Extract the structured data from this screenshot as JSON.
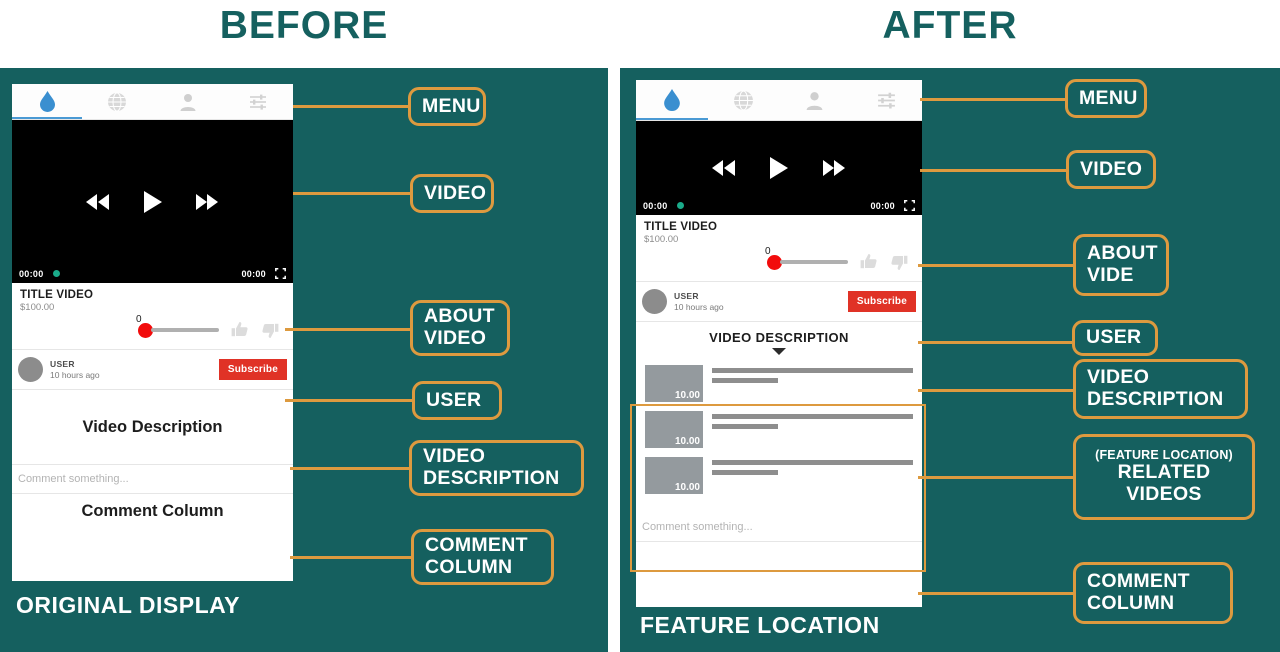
{
  "headings": {
    "before": "BEFORE",
    "after": "AFTER"
  },
  "captions": {
    "before": "ORIGINAL DISPLAY",
    "after": "FEATURE LOCATION"
  },
  "colors": {
    "panel_teal": "#15605F",
    "callout_orange": "#DD9A3F",
    "heading_teal": "#15605F",
    "subscribe_red": "#E03226",
    "slider_red": "#F20C0C",
    "progress_green": "#1AAB8A",
    "tab_active_blue": "#4A9AD4",
    "thumb_gray": "#949A9E"
  },
  "app": {
    "nav": {
      "items": [
        {
          "icon": "water-drop-icon",
          "active": true
        },
        {
          "icon": "globe-icon",
          "active": false
        },
        {
          "icon": "person-icon",
          "active": false
        },
        {
          "icon": "sliders-settings-icon",
          "active": false
        }
      ]
    },
    "player": {
      "rewind_icon": "rewind-icon",
      "play_icon": "play-icon",
      "forward_icon": "fast-forward-icon",
      "current_time": "00:00",
      "total_time": "00:00",
      "fullscreen_icon": "fullscreen-icon"
    },
    "about_video": {
      "title": "TITLE VIDEO",
      "price": "$100.00",
      "slider_value": "0",
      "like_icon": "thumbs-up-icon",
      "dislike_icon": "thumbs-down-icon"
    },
    "user": {
      "name": "USER",
      "time": "10 hours ago",
      "subscribe_label": "Subscribe"
    },
    "description_before": "Video Description",
    "description_after": {
      "title": "VIDEO DESCRIPTION",
      "caret_icon": "caret-down-icon"
    },
    "related_videos": [
      {
        "price": "10.00"
      },
      {
        "price": "10.00"
      },
      {
        "price": "10.00"
      }
    ],
    "comment": {
      "placeholder": "Comment something...",
      "column_label": "Comment Column"
    }
  },
  "callouts": {
    "before": [
      {
        "lines": [
          "MENU"
        ]
      },
      {
        "lines": [
          "VIDEO"
        ]
      },
      {
        "lines": [
          "ABOUT",
          "VIDEO"
        ]
      },
      {
        "lines": [
          "USER"
        ]
      },
      {
        "lines": [
          "VIDEO",
          "DESCRIPTION"
        ]
      },
      {
        "lines": [
          "COMMENT",
          "COLUMN"
        ]
      }
    ],
    "after": [
      {
        "lines": [
          "MENU"
        ]
      },
      {
        "lines": [
          "VIDEO"
        ]
      },
      {
        "lines": [
          "ABOUT",
          "VIDE"
        ]
      },
      {
        "lines": [
          "USER"
        ]
      },
      {
        "lines": [
          "VIDEO",
          "DESCRIPTION"
        ]
      },
      {
        "small": "(FEATURE LOCATION)",
        "lines": [
          "RELATED",
          "VIDEOS"
        ]
      },
      {
        "lines": [
          "COMMENT",
          "COLUMN"
        ]
      }
    ]
  }
}
